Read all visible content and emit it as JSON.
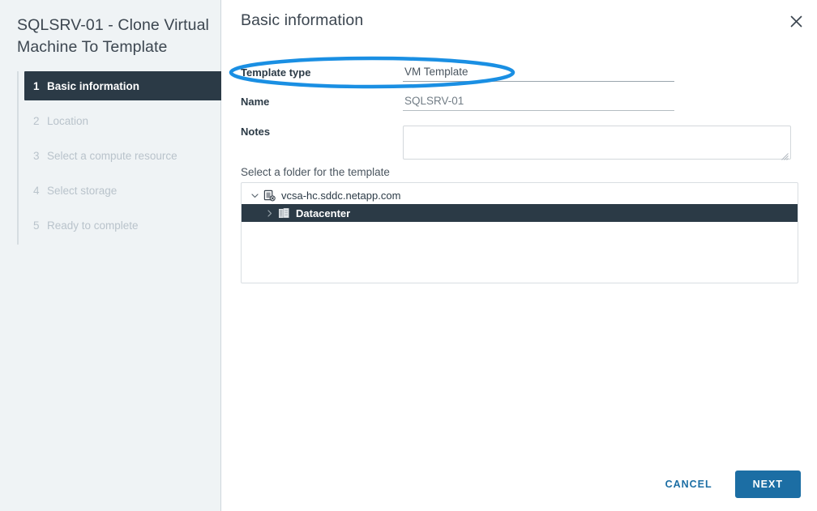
{
  "sidebar": {
    "wizard_title": "SQLSRV-01 - Clone Virtual Machine To Template",
    "steps": [
      {
        "number": "1",
        "label": "Basic information"
      },
      {
        "number": "2",
        "label": "Location"
      },
      {
        "number": "3",
        "label": "Select a compute resource"
      },
      {
        "number": "4",
        "label": "Select storage"
      },
      {
        "number": "5",
        "label": "Ready to complete"
      }
    ]
  },
  "main": {
    "heading": "Basic information",
    "close_icon": "close-icon",
    "form": {
      "template_type": {
        "label": "Template type",
        "value": "VM Template"
      },
      "name": {
        "label": "Name",
        "value": "SQLSRV-01"
      },
      "notes": {
        "label": "Notes",
        "value": "",
        "placeholder": ""
      }
    },
    "tree": {
      "caption": "Select a folder for the template",
      "nodes": [
        {
          "label": "vcsa-hc.sddc.netapp.com",
          "icon": "vcenter-server-icon",
          "twisty": "chevron-down-icon",
          "expanded": true,
          "selected": false
        },
        {
          "label": "Datacenter",
          "icon": "datacenter-icon",
          "twisty": "chevron-right-icon",
          "expanded": false,
          "selected": true
        }
      ]
    }
  },
  "footer": {
    "cancel_label": "CANCEL",
    "next_label": "NEXT"
  },
  "annotation": {
    "shape": "ellipse-highlight",
    "target": "Template type",
    "color": "#1a8fe3"
  },
  "colors": {
    "accent": "#1c6ea4",
    "annotation": "#1a8fe3",
    "selected_row": "#2b3a46",
    "sidebar_bg": "#eff3f5"
  }
}
